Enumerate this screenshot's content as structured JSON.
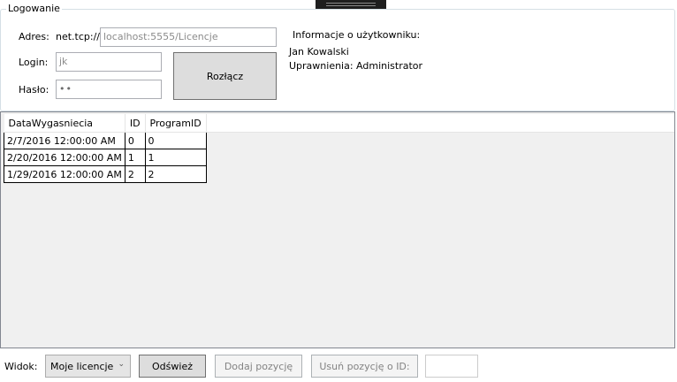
{
  "login_group": {
    "title": "Logowanie",
    "address_label": "Adres:",
    "address_prefix": "net.tcp://",
    "address_value": "localhost:5555/Licencje",
    "login_label": "Login:",
    "login_value": "jk",
    "password_label": "Hasło:",
    "password_value": "••",
    "disconnect_label": "Rozłącz"
  },
  "user_info": {
    "title": "Informacje o użytkowniku:",
    "name": "Jan Kowalski",
    "permissions": "Uprawnienia: Administrator"
  },
  "grid": {
    "columns": [
      "DataWygasniecia",
      "ID",
      "ProgramID"
    ],
    "rows": [
      [
        "2/7/2016 12:00:00 AM",
        "0",
        "0"
      ],
      [
        "2/20/2016 12:00:00 AM",
        "1",
        "1"
      ],
      [
        "1/29/2016 12:00:00 AM",
        "2",
        "2"
      ]
    ]
  },
  "toolbar": {
    "view_label": "Widok:",
    "view_selected": "Moje licencje",
    "refresh_label": "Odśwież",
    "add_label": "Dodaj pozycję",
    "remove_label": "Usuń pozycję o ID:",
    "remove_id_value": ""
  }
}
